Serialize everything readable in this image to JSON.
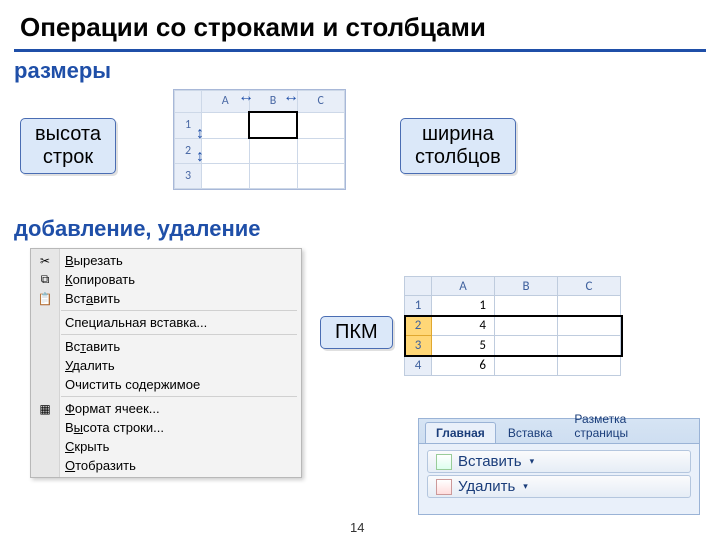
{
  "title": "Операции со строками и столбцами",
  "sections": {
    "sizes": "размеры",
    "addremove": "добавление, удаление"
  },
  "callouts": {
    "row_height": "высота\nстрок",
    "col_width": "ширина\nстолбцов",
    "rmb": "ПКМ"
  },
  "size_grid": {
    "cols": [
      "A",
      "B",
      "C"
    ],
    "rows": [
      "1",
      "2",
      "3"
    ]
  },
  "data_grid": {
    "cols": [
      "A",
      "B",
      "C"
    ],
    "rows": [
      {
        "n": "1",
        "a": "1",
        "b": "",
        "c": ""
      },
      {
        "n": "2",
        "a": "4",
        "b": "",
        "c": ""
      },
      {
        "n": "3",
        "a": "5",
        "b": "",
        "c": ""
      },
      {
        "n": "4",
        "a": "6",
        "b": "",
        "c": ""
      }
    ],
    "selected_rows": [
      "2",
      "3"
    ]
  },
  "context_menu": [
    {
      "icon": "✂",
      "label": "Вырезать",
      "u": 0
    },
    {
      "icon": "⧉",
      "label": "Копировать",
      "u": 0
    },
    {
      "icon": "📋",
      "label": "Вставить",
      "u": 3
    },
    {
      "sep": true
    },
    {
      "icon": "",
      "label": "Специальная вставка...",
      "u": -1
    },
    {
      "sep": true
    },
    {
      "icon": "",
      "label": "Вставить",
      "u": 2
    },
    {
      "icon": "",
      "label": "Удалить",
      "u": 0
    },
    {
      "icon": "",
      "label": "Очистить содержимое",
      "u": -1
    },
    {
      "sep": true
    },
    {
      "icon": "▦",
      "label": "Формат ячеек...",
      "u": 0
    },
    {
      "icon": "",
      "label": "Высота строки...",
      "u": 1
    },
    {
      "icon": "",
      "label": "Скрыть",
      "u": 0
    },
    {
      "icon": "",
      "label": "Отобразить",
      "u": 0
    }
  ],
  "ribbon": {
    "tabs": [
      "Главная",
      "Вставка",
      "Разметка страницы"
    ],
    "active": 0,
    "buttons": {
      "insert": "Вставить",
      "delete": "Удалить"
    }
  },
  "page_number": "14"
}
